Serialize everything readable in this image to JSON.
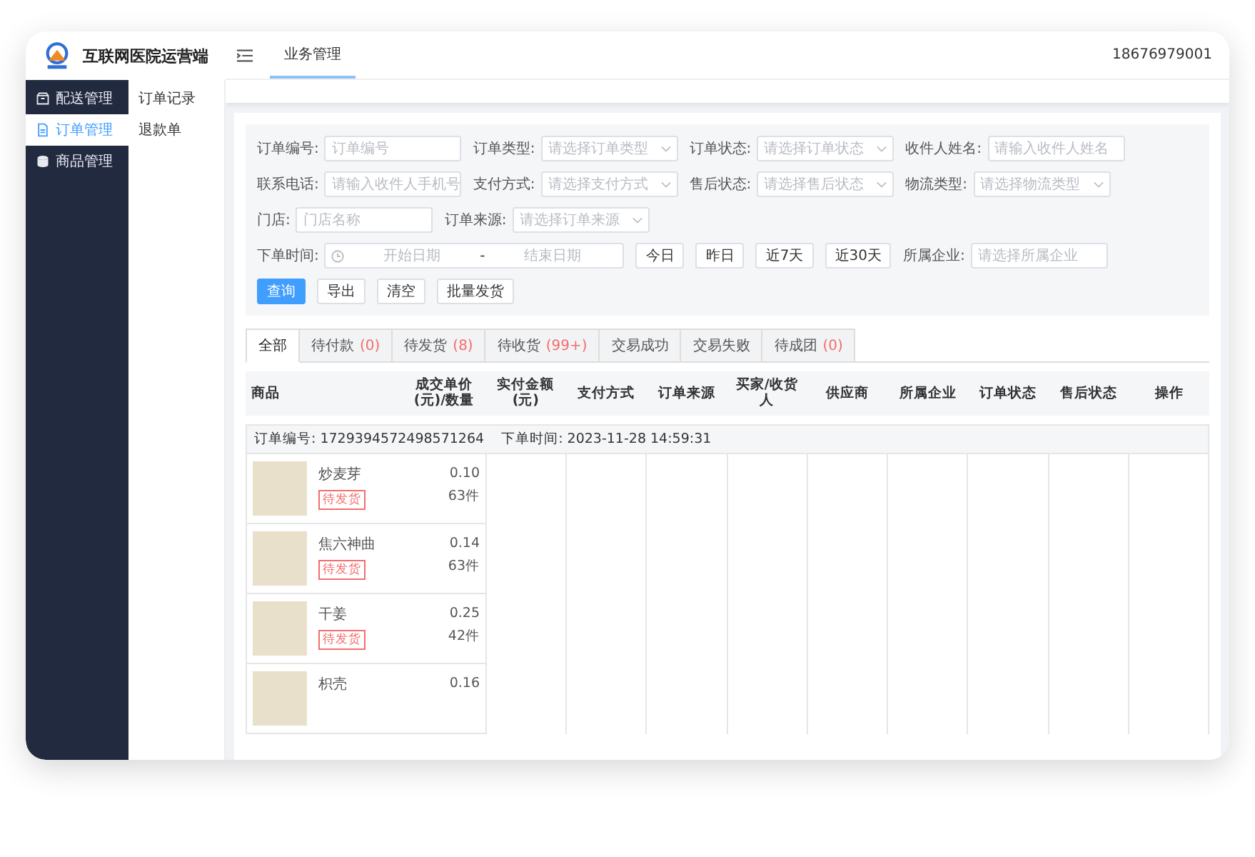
{
  "app": {
    "title": "互联网医院运营端",
    "user": "18676979001"
  },
  "top_tabs": [
    {
      "label": "业务管理",
      "selected": true
    }
  ],
  "sidebar": {
    "items": [
      {
        "label": "配送管理",
        "selected": false
      },
      {
        "label": "订单管理",
        "selected": true
      },
      {
        "label": "商品管理",
        "selected": false
      }
    ]
  },
  "submenu": {
    "items": [
      {
        "label": "订单记录",
        "selected": false
      },
      {
        "label": "退款单",
        "selected": false
      }
    ]
  },
  "filters": {
    "fields": [
      {
        "kind": "input",
        "label": "订单编号:",
        "placeholder": "订单编号"
      },
      {
        "kind": "select",
        "label": "订单类型:",
        "placeholder": "请选择订单类型"
      },
      {
        "kind": "select",
        "label": "订单状态:",
        "placeholder": "请选择订单状态"
      },
      {
        "kind": "input",
        "label": "收件人姓名:",
        "placeholder": "请输入收件人姓名"
      },
      {
        "kind": "input",
        "label": "联系电话:",
        "placeholder": "请输入收件人手机号"
      },
      {
        "kind": "select",
        "label": "支付方式:",
        "placeholder": "请选择支付方式"
      },
      {
        "kind": "select",
        "label": "售后状态:",
        "placeholder": "请选择售后状态"
      },
      {
        "kind": "select",
        "label": "物流类型:",
        "placeholder": "请选择物流类型"
      },
      {
        "kind": "input",
        "label": "门店:",
        "placeholder": "门店名称"
      },
      {
        "kind": "select",
        "label": "订单来源:",
        "placeholder": "请选择订单来源"
      }
    ],
    "date_range": {
      "label": "下单时间:",
      "start": "开始日期",
      "separator": "-",
      "end": "结束日期"
    },
    "quick_ranges": [
      "今日",
      "昨日",
      "近7天",
      "近30天"
    ],
    "company": {
      "label": "所属企业:",
      "placeholder": "请选择所属企业"
    },
    "actions": [
      {
        "label": "查询",
        "kind": "primary"
      },
      {
        "label": "导出",
        "kind": "default"
      },
      {
        "label": "清空",
        "kind": "default"
      },
      {
        "label": "批量发货",
        "kind": "default"
      }
    ]
  },
  "status_tabs": [
    {
      "label": "全部",
      "selected": true
    },
    {
      "label": "待付款",
      "count": "(0)",
      "selected": false
    },
    {
      "label": "待发货",
      "count": "(8)",
      "selected": false
    },
    {
      "label": "待收货",
      "count": "(99+)",
      "selected": false
    },
    {
      "label": "交易成功",
      "selected": false
    },
    {
      "label": "交易失败",
      "selected": false
    },
    {
      "label": "待成团",
      "count": "(0)",
      "selected": false
    }
  ],
  "table": {
    "columns": [
      "商品",
      "成交单价(元)/数量",
      "实付金额(元)",
      "支付方式",
      "订单来源",
      "买家/收货人",
      "供应商",
      "所属企业",
      "订单状态",
      "售后状态",
      "操作"
    ],
    "orders": [
      {
        "order_no_label": "订单编号:",
        "order_no": "1729394572498571264",
        "time_label": "下单时间:",
        "time": "2023-11-28 14:59:31",
        "items": [
          {
            "name": "炒麦芽",
            "tag": "待发货",
            "price": "0.10",
            "qty": "63件"
          },
          {
            "name": "焦六神曲",
            "tag": "待发货",
            "price": "0.14",
            "qty": "63件"
          },
          {
            "name": "干姜",
            "tag": "待发货",
            "price": "0.25",
            "qty": "42件"
          },
          {
            "name": "枳壳",
            "price": "0.16"
          }
        ]
      }
    ]
  }
}
